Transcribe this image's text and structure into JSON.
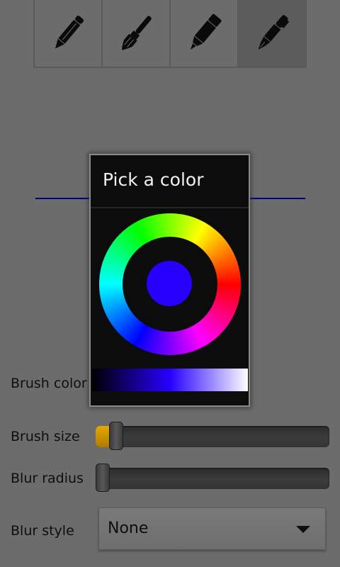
{
  "toolbar": {
    "tools": [
      {
        "icon": "pencil-icon",
        "selected": false
      },
      {
        "icon": "paint-brush-icon",
        "selected": false
      },
      {
        "icon": "marker-icon",
        "selected": false
      },
      {
        "icon": "fountain-pen-icon",
        "selected": true
      }
    ]
  },
  "preview": {
    "stroke_color": "#00008c"
  },
  "settings": {
    "brush_color_label": "Brush color",
    "brush_size_label": "Brush size",
    "brush_size_value": 0.06,
    "blur_radius_label": "Blur radius",
    "blur_radius_value": 0.0,
    "blur_style_label": "Blur style",
    "blur_style_value": "None"
  },
  "color_picker": {
    "title": "Pick a color",
    "selected_color": "#2600ff",
    "value_bar_colors": [
      "#000000",
      "#2600ff",
      "#ffffff"
    ]
  },
  "colors": {
    "background": "#6c6c6c",
    "accent": "#e6a800",
    "dialog_background": "#0c0c0c"
  }
}
